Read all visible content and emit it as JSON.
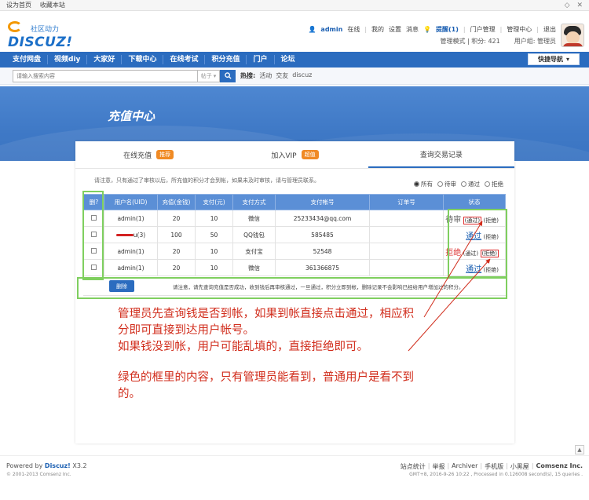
{
  "topbar": {
    "links": [
      "设为首页",
      "收藏本站"
    ],
    "controls": [
      "◇",
      "✕"
    ]
  },
  "header": {
    "logo_badge": "社区动力",
    "logo_text": "DISCUZ!",
    "user": {
      "name": "admin",
      "online_status": "在线",
      "menu": [
        "我的",
        "设置",
        "消息"
      ],
      "alert": "提醒(1)",
      "admin_links": [
        "门户管理",
        "管理中心",
        "退出"
      ]
    },
    "meta": {
      "mode": "管理模式",
      "points": "积分: 421",
      "group": "用户组: 管理员"
    }
  },
  "nav": {
    "items": [
      "支付网盘",
      "视频diy",
      "大家好",
      "下载中心",
      "在线考试",
      "积分充值",
      "门户",
      "论坛"
    ],
    "quick_label": "快捷导航"
  },
  "search": {
    "placeholder": "请输入搜索内容",
    "type": "帖子",
    "hot_label": "热搜:",
    "hot_terms": [
      "活动",
      "交友",
      "discuz"
    ]
  },
  "banner": {
    "title": "充值中心"
  },
  "tabs": [
    {
      "label": "在线充值",
      "tag": "推荐"
    },
    {
      "label": "加入VIP",
      "tag": "超值"
    },
    {
      "label": "查询交易记录",
      "tag": ""
    }
  ],
  "notice": "请注意，只有通过了审核以后，所充值的积分才会到帐，如果未及时审核，请与管理员联系。",
  "filters": {
    "options": [
      "所有",
      "待审",
      "通过",
      "拒绝"
    ],
    "selected": "所有"
  },
  "table": {
    "headers": [
      "删?",
      "用户名(UID)",
      "充值(金钱)",
      "支付(元)",
      "支付方式",
      "支付帐号",
      "订单号",
      "状态"
    ],
    "rows": [
      {
        "user": "admin(1)",
        "credit": "20",
        "pay": "10",
        "method": "微信",
        "account": "25233434@qq.com",
        "order": "",
        "status": "待审",
        "actions": [
          "通过",
          "拒绝"
        ]
      },
      {
        "user": "u(3)",
        "credit": "100",
        "pay": "50",
        "method": "QQ钱包",
        "account": "585485",
        "order": "",
        "status": "通过",
        "actions": [
          "拒绝"
        ]
      },
      {
        "user": "admin(1)",
        "credit": "20",
        "pay": "10",
        "method": "支付宝",
        "account": "52548",
        "order": "",
        "status": "拒绝",
        "actions": [
          "通过",
          "拒绝"
        ]
      },
      {
        "user": "admin(1)",
        "credit": "20",
        "pay": "10",
        "method": "微信",
        "account": "361366875",
        "order": "",
        "status": "通过",
        "actions": [
          "拒绝"
        ]
      }
    ]
  },
  "actions": {
    "delete_label": "删除",
    "tip": "请注意，请先查询充值是否成功，收到钱后再审核通过，一旦通过，积分立即到帐，删除记录不会影响已经给用户增加过的积分。"
  },
  "annotation": {
    "lines": [
      "管理员先查询钱是否到帐，如果到帐直接点击通过，相应积",
      "分即可直接到达用户帐号。",
      "如果钱没到帐，用户可能乱填的，直接拒绝即可。",
      "",
      "绿色的框里的内容，只有管理员能看到，普通用户是看不到",
      "的。"
    ]
  },
  "footer": {
    "powered": "Powered by",
    "brand": "Discuz!",
    "version": "X3.2",
    "copyright": "© 2001-2013 Comsenz Inc.",
    "links": [
      "站点统计",
      "举报",
      "Archiver",
      "手机版",
      "小黑屋"
    ],
    "company": "Comsenz Inc.",
    "gmt": "GMT+8, 2016-9-26 10:22 , Processed in 0.126008 second(s), 15 queries ."
  },
  "colors": {
    "nav_blue": "#2b6cbf",
    "annotation_red": "#d12d1c",
    "annotation_green": "#7fcf5f",
    "tag_orange": "#f08a24"
  }
}
